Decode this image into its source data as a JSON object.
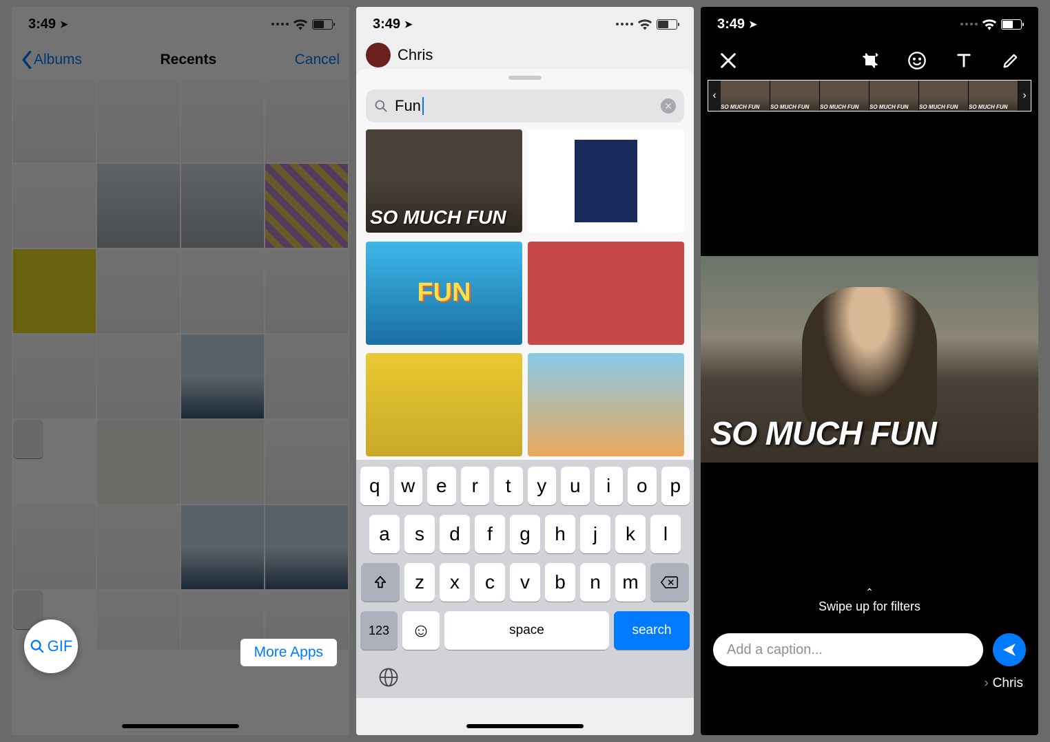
{
  "shared": {
    "time": "3:49"
  },
  "panel1": {
    "back_label": "Albums",
    "title": "Recents",
    "cancel_label": "Cancel",
    "gif_label": "GIF",
    "more_apps_label": "More Apps"
  },
  "panel2": {
    "contact_name": "Chris",
    "search_value": "Fun",
    "gif1_caption": "SO MUCH FUN",
    "gif3_text": "FUN",
    "keyboard": {
      "row1": [
        "q",
        "w",
        "e",
        "r",
        "t",
        "y",
        "u",
        "i",
        "o",
        "p"
      ],
      "row2": [
        "a",
        "s",
        "d",
        "f",
        "g",
        "h",
        "j",
        "k",
        "l"
      ],
      "row3": [
        "z",
        "x",
        "c",
        "v",
        "b",
        "n",
        "m"
      ],
      "num_label": "123",
      "space_label": "space",
      "action_label": "search"
    }
  },
  "panel3": {
    "frame_label": "SO MUCH FUN",
    "main_text": "SO MUCH FUN",
    "swipe_label": "Swipe up for filters",
    "caption_placeholder": "Add a caption...",
    "recipient": "Chris"
  }
}
